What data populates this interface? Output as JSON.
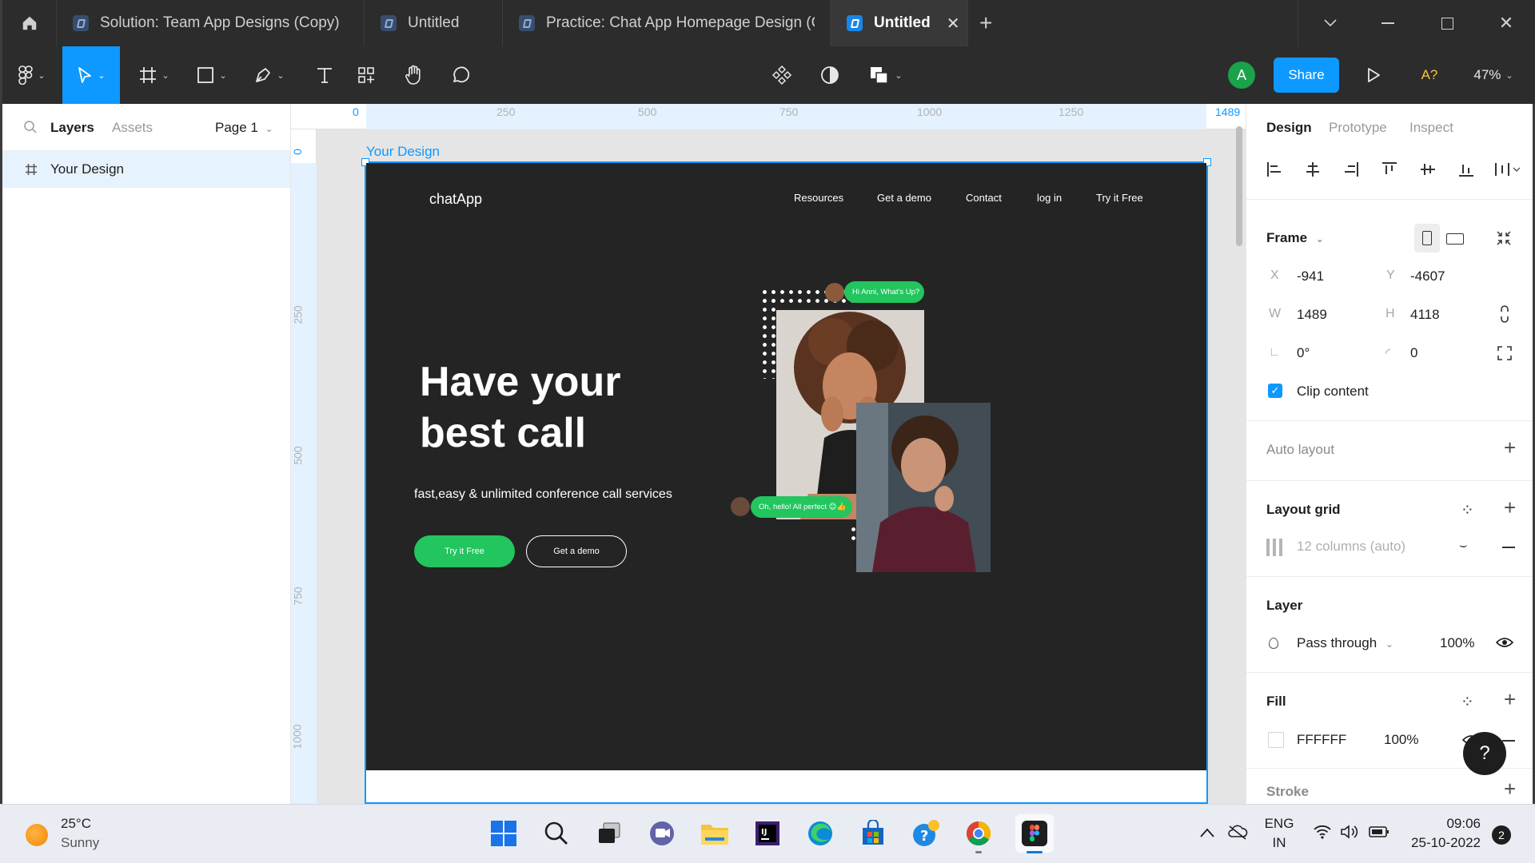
{
  "tabs": [
    {
      "title": "Solution: Team App Designs (Copy)"
    },
    {
      "title": "Untitled"
    },
    {
      "title": "Practice: Chat App Homepage Design (Copy)"
    },
    {
      "title": "Untitled"
    }
  ],
  "toolbar": {
    "avatar_initial": "A",
    "share_label": "Share",
    "font_missing": "A?",
    "zoom": "47%"
  },
  "left_panel": {
    "tab_layers": "Layers",
    "tab_assets": "Assets",
    "page": "Page 1",
    "layer_name": "Your Design"
  },
  "rulers": {
    "top": [
      "0",
      "250",
      "500",
      "750",
      "1000",
      "1250",
      "1489"
    ],
    "left": [
      "0",
      "250",
      "500",
      "750",
      "1000"
    ]
  },
  "frame": {
    "label": "Your Design",
    "brand": "chatApp",
    "nav": [
      "Resources",
      "Get a demo",
      "Contact",
      "log in",
      "Try it Free"
    ],
    "headline_line1": "Have your",
    "headline_line2": "best call",
    "subtitle": "fast,easy & unlimited conference call services",
    "cta_primary": "Try it Free",
    "cta_secondary": "Get a demo",
    "bubble_top": "Hi Anni, What's Up?",
    "bubble_bottom": "Oh, hello! All perfect 😊👍"
  },
  "right_panel": {
    "tabs": [
      "Design",
      "Prototype",
      "Inspect"
    ],
    "frame_title": "Frame",
    "x_label": "X",
    "x": "-941",
    "y_label": "Y",
    "y": "-4607",
    "w_label": "W",
    "w": "1489",
    "h_label": "H",
    "h": "4118",
    "rotation": "0°",
    "radius": "0",
    "clip_content": "Clip content",
    "auto_layout": "Auto layout",
    "layout_grid": "Layout grid",
    "grid_desc": "12 columns (auto)",
    "layer_title": "Layer",
    "blend": "Pass through",
    "layer_opacity": "100%",
    "fill_title": "Fill",
    "fill_hex": "FFFFFF",
    "fill_opacity": "100%",
    "stroke_title": "Stroke",
    "help": "?"
  },
  "taskbar": {
    "temp": "25°C",
    "weather": "Sunny",
    "lang1": "ENG",
    "lang2": "IN",
    "time": "09:06",
    "date": "25-10-2022",
    "notifications": "2"
  },
  "colors": {
    "accent": "#0d99ff",
    "green": "#22c55e",
    "dark_frame": "#242424",
    "toolbar": "#2c2c2c"
  }
}
